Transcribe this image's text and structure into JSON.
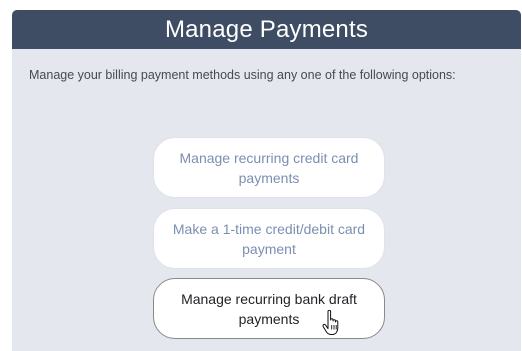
{
  "header": {
    "title": "Manage Payments"
  },
  "intro": {
    "text": "Manage your billing payment methods using any one of the following options:"
  },
  "options": [
    {
      "label": "Manage recurring credit card payments"
    },
    {
      "label": "Make a 1-time credit/debit card payment"
    },
    {
      "label": "Manage recurring bank draft payments",
      "state": "hovered"
    }
  ],
  "cursor": {
    "icon": "hand-pointer-icon"
  },
  "colors": {
    "header_bg": "#3e4d63",
    "panel_bg": "#e4e7ed",
    "button_text": "#7b8fb1",
    "button_text_hover": "#1f2126"
  }
}
